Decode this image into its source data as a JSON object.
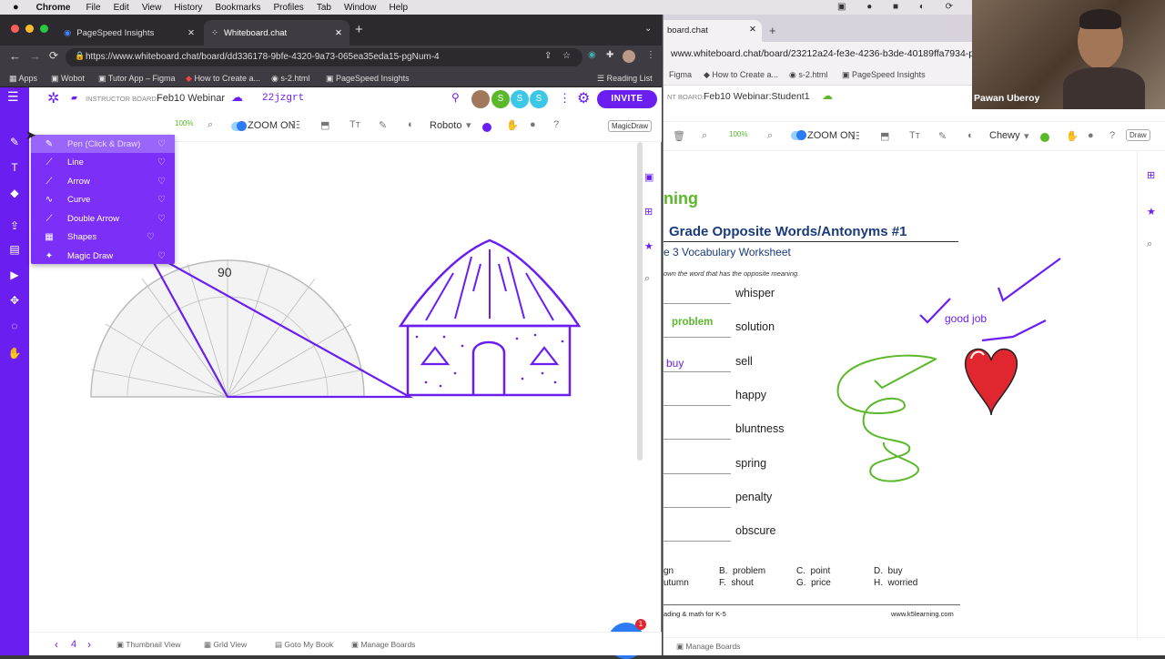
{
  "mac": {
    "apple": "",
    "app": "Chrome",
    "menus": [
      "File",
      "Edit",
      "View",
      "History",
      "Bookmarks",
      "Profiles",
      "Tab",
      "Window",
      "Help"
    ]
  },
  "left": {
    "tabs": [
      {
        "title": "PageSpeed Insights"
      },
      {
        "title": "Whiteboard.chat"
      }
    ],
    "url": "https://www.whiteboard.chat/board/dd336178-9bfe-4320-9a73-065ea35eda15-pgNum-4",
    "bookmarks": [
      "Apps",
      "Wobot",
      "Tutor App – Figma",
      "How to Create a...",
      "s-2.html",
      "PageSpeed Insights"
    ],
    "reading_list": "Reading List",
    "header": {
      "label": "INSTRUCTOR BOARD:",
      "board": "Feb10 Webinar",
      "code": "22jzgrt",
      "invite": "INVITE",
      "avatars": [
        "S",
        "S",
        "S"
      ]
    },
    "toolbar": {
      "zoom": "100%",
      "zoom_on": "ZOOM ON",
      "font": "Roboto",
      "magic": "MagicDraw"
    },
    "menu": [
      {
        "label": "Pen (Click & Draw)",
        "icon": "✎"
      },
      {
        "label": "Line",
        "icon": "⟋"
      },
      {
        "label": "Arrow",
        "icon": "⟋"
      },
      {
        "label": "Curve",
        "icon": "∿"
      },
      {
        "label": "Double Arrow",
        "icon": "⟋"
      },
      {
        "label": "Shapes",
        "icon": "▦"
      },
      {
        "label": "Magic Draw",
        "icon": "✦"
      }
    ],
    "protractor_label": "90",
    "bottom": {
      "page": "4",
      "thumb": "Thumbnail View",
      "grid": "Grid View",
      "goto": "Goto My Book",
      "manage": "Manage Boards"
    },
    "chat_badge": "1"
  },
  "right": {
    "tab_title": "board.chat",
    "url": "www.whiteboard.chat/board/23212a24-fe3e-4236-b3de-40189ffa7934-p",
    "bookmarks": [
      "Figma",
      "How to Create a...",
      "s-2.html",
      "PageSpeed Insights"
    ],
    "header": {
      "label": "NT BOARD:",
      "board": "Feb10 Webinar:Student1"
    },
    "toolbar": {
      "zoom": "100%",
      "zoom_on": "ZOOM ON",
      "font": "Chewy",
      "draw": "Draw"
    },
    "worksheet": {
      "logo": "ning",
      "title": "Grade Opposite Words/Antonyms #1",
      "subtitle": "e 3 Vocabulary Worksheet",
      "instr": "own the word that has the opposite meaning.",
      "words": [
        "whisper",
        "solution",
        "sell",
        "happy",
        "bluntness",
        "spring",
        "penalty",
        "obscure"
      ],
      "answers": {
        "problem": "problem",
        "buy": "buy"
      },
      "options": [
        "gn",
        "B.  problem",
        "C.  point",
        "D.  buy",
        "utumn",
        "F.  shout",
        "G.  price",
        "H.  worried"
      ],
      "footer_left": "ading & math for K-5",
      "footer_right": "www.k5learning.com"
    },
    "annotation": "good job",
    "bottom": {
      "manage": "Manage Boards"
    }
  },
  "video": {
    "name": "Pawan Uberoy"
  },
  "colors": {
    "purple": "#6a1ef0",
    "accent": "#7b2ff7",
    "green": "#5ab82a",
    "red": "#e0262e"
  }
}
